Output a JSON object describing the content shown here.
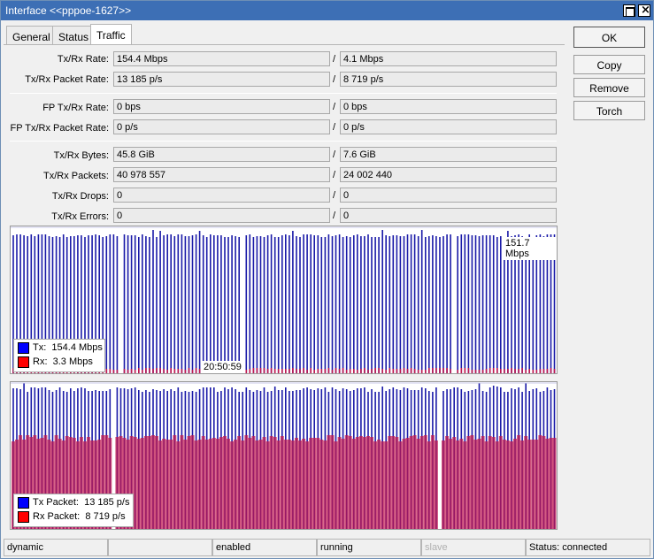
{
  "window": {
    "title": "Interface <<pppoe-1627>>"
  },
  "tabs": [
    {
      "label": "General",
      "active": false
    },
    {
      "label": "Status",
      "active": false
    },
    {
      "label": "Traffic",
      "active": true
    }
  ],
  "buttons": {
    "ok": "OK",
    "copy": "Copy",
    "remove": "Remove",
    "torch": "Torch"
  },
  "stats": {
    "txrx_rate": {
      "label": "Tx/Rx Rate:",
      "tx": "154.4 Mbps",
      "rx": "4.1 Mbps"
    },
    "txrx_packet_rate": {
      "label": "Tx/Rx Packet Rate:",
      "tx": "13 185 p/s",
      "rx": "8 719 p/s"
    },
    "fp_txrx_rate": {
      "label": "FP Tx/Rx Rate:",
      "tx": "0 bps",
      "rx": "0 bps"
    },
    "fp_txrx_packet_rate": {
      "label": "FP Tx/Rx Packet Rate:",
      "tx": "0 p/s",
      "rx": "0 p/s"
    },
    "txrx_bytes": {
      "label": "Tx/Rx Bytes:",
      "tx": "45.8 GiB",
      "rx": "7.6 GiB"
    },
    "txrx_packets": {
      "label": "Tx/Rx Packets:",
      "tx": "40 978 557",
      "rx": "24 002 440"
    },
    "txrx_drops": {
      "label": "Tx/Rx Drops:",
      "tx": "0",
      "rx": "0"
    },
    "txrx_errors": {
      "label": "Tx/Rx Errors:",
      "tx": "0",
      "rx": "0"
    },
    "separator": "/"
  },
  "traffic_graph": {
    "peak_label": "151.7 Mbps",
    "time_label": "20:50:59",
    "legend": [
      {
        "label": "Tx:",
        "value": "154.4 Mbps",
        "color": "#0000ff"
      },
      {
        "label": "Rx:",
        "value": "3.3 Mbps",
        "color": "#ff0000"
      }
    ]
  },
  "packet_graph": {
    "legend": [
      {
        "label": "Tx Packet:",
        "value": "13 185 p/s",
        "color": "#0000ff"
      },
      {
        "label": "Rx Packet:",
        "value": "8 719 p/s",
        "color": "#ff0000"
      }
    ]
  },
  "colors": {
    "tx": "#1a1aa8",
    "rx": "#c01850",
    "title_bar": "#3d6fb5"
  },
  "statusbar": [
    "dynamic",
    "",
    "enabled",
    "running",
    "slave",
    "Status: connected"
  ]
}
